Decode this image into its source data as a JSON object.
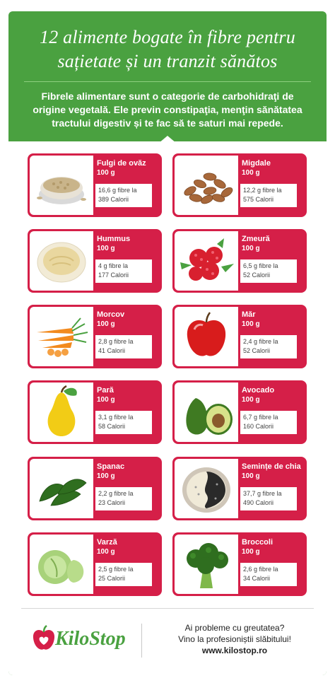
{
  "header": {
    "title_line1": "12 alimente bogate în fibre pentru",
    "title_line2": "sațietate și un tranzit sănătos",
    "intro_line1": "Fibrele alimentare sunt o categorie de carbohidraţi de",
    "intro_line2": "origine vegetală. Ele previn constipaţia, menţin sănătatea",
    "intro_line3": "tractului digestiv și te fac să te saturi mai repede."
  },
  "foods": [
    {
      "name": "Fulgi de ovăz",
      "qty": "100 g",
      "fibre": "16,6 g fibre la",
      "cal": "389 Calorii",
      "icon": "oats-icon"
    },
    {
      "name": "Migdale",
      "qty": "100 g",
      "fibre": "12,2 g fibre la",
      "cal": "575 Calorii",
      "icon": "almonds-icon"
    },
    {
      "name": "Hummus",
      "qty": "100 g",
      "fibre": "4 g fibre la",
      "cal": "177 Calorii",
      "icon": "hummus-icon"
    },
    {
      "name": "Zmeură",
      "qty": "100 g",
      "fibre": "6,5 g fibre la",
      "cal": "52 Calorii",
      "icon": "raspberry-icon"
    },
    {
      "name": "Morcov",
      "qty": "100 g",
      "fibre": "2,8 g fibre la",
      "cal": "41 Calorii",
      "icon": "carrot-icon"
    },
    {
      "name": "Măr",
      "qty": "100 g",
      "fibre": "2,4 g fibre la",
      "cal": "52 Calorii",
      "icon": "apple-icon"
    },
    {
      "name": "Pară",
      "qty": "100 g",
      "fibre": "3,1 g fibre la",
      "cal": "58 Calorii",
      "icon": "pear-icon"
    },
    {
      "name": "Avocado",
      "qty": "100 g",
      "fibre": "6,7 g fibre la",
      "cal": "160 Calorii",
      "icon": "avocado-icon"
    },
    {
      "name": "Spanac",
      "qty": "100 g",
      "fibre": "2,2 g fibre la",
      "cal": "23 Calorii",
      "icon": "spinach-icon"
    },
    {
      "name": "Semințe de chia",
      "qty": "100 g",
      "fibre": "37,7 g fibre la",
      "cal": "490 Calorii",
      "icon": "chia-seeds-icon"
    },
    {
      "name": "Varză",
      "qty": "100 g",
      "fibre": "2,5 g fibre la",
      "cal": "25 Calorii",
      "icon": "cabbage-icon"
    },
    {
      "name": "Broccoli",
      "qty": "100 g",
      "fibre": "2,6 g fibre la",
      "cal": "34 Calorii",
      "icon": "broccoli-icon"
    }
  ],
  "footer": {
    "brand": "KiloStop",
    "line1": "Ai probleme cu greutatea?",
    "line2": "Vino la profesioniștii slăbitului!",
    "url": "www.kilostop.ro"
  },
  "colors": {
    "green": "#4aa140",
    "red": "#d51f48",
    "white": "#ffffff"
  }
}
